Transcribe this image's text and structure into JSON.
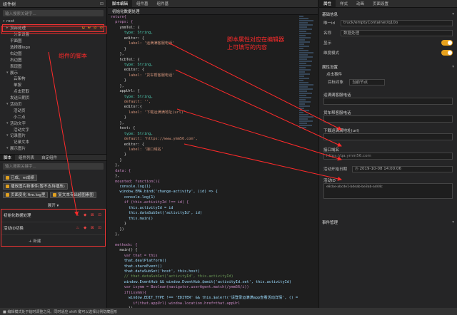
{
  "left": {
    "component_tree_title": "组件树",
    "search_placeholder": "输入搜索关键字...",
    "tree": [
      {
        "label": "root",
        "indent": 0,
        "arrow": "▾"
      },
      {
        "label": "顶部处理",
        "indent": 1,
        "arrow": "▸",
        "selected": true
      },
      {
        "label": "分享设置",
        "indent": 2,
        "arrow": ""
      },
      {
        "label": "平面图",
        "indent": 1,
        "arrow": ""
      },
      {
        "label": "选择器logo",
        "indent": 1,
        "arrow": ""
      },
      {
        "label": "右边图",
        "indent": 1,
        "arrow": ""
      },
      {
        "label": "右边图",
        "indent": 1,
        "arrow": ""
      },
      {
        "label": "表现图",
        "indent": 1,
        "arrow": ""
      },
      {
        "label": "展示",
        "indent": 1,
        "arrow": "▾"
      },
      {
        "label": "云架构",
        "indent": 2,
        "arrow": ""
      },
      {
        "label": "单按",
        "indent": 2,
        "arrow": ""
      },
      {
        "label": "点击获取",
        "indent": 2,
        "arrow": ""
      },
      {
        "label": "发送日期页",
        "indent": 1,
        "arrow": ""
      },
      {
        "label": "活动页",
        "indent": 1,
        "arrow": "▾"
      },
      {
        "label": "活动页",
        "indent": 2,
        "arrow": ""
      },
      {
        "label": "小二点",
        "indent": 2,
        "arrow": ""
      },
      {
        "label": "活动文字",
        "indent": 1,
        "arrow": "▾"
      },
      {
        "label": "活动文字",
        "indent": 2,
        "arrow": ""
      },
      {
        "label": "记录图片",
        "indent": 1,
        "arrow": "▾"
      },
      {
        "label": "记录文本",
        "indent": 2,
        "arrow": ""
      },
      {
        "label": "展示图片",
        "indent": 1,
        "arrow": "▾"
      }
    ],
    "tree_actions": "⧉ ⊕ ◎ ⊘",
    "bottom_tabs": [
      "脚本",
      "组件列表",
      "自定组件"
    ],
    "script_search_placeholder": "输入搜索关键字...",
    "chips": [
      "已成、m成绩",
      "播放图片新事件(暂不支持播放)",
      "页面变化 fire.log里",
      "复文本专出超图素图"
    ],
    "more_label": "展开 ▾",
    "scripts": [
      {
        "label": "初始化数据处理"
      },
      {
        "label": "活动ID切换"
      }
    ],
    "script_icons": "♨ ◆ ⊠ ⊡",
    "new_label": "+ 新建",
    "script_annotation": "组件的脚本"
  },
  "middle": {
    "tabs": [
      "脚本编辑",
      "组件墓",
      "组件墓"
    ],
    "file_tab": "初始化数据处理",
    "code_lines": [
      "return{",
      "  props: {",
      "    ymmTel: {",
      "      type: String,",
      "      editor: {",
      "        label: '运满满客服电话'",
      "      }",
      "    },",
      "    hcbTel: {",
      "      type: String,",
      "      editor: {",
      "        label: '货车帮客服电话'",
      "      }",
      "    },",
      "    appUrl: {",
      "      type: String,",
      "      default: '',",
      "      editor:{",
      "        label: '下载运满满地址(url)'",
      "      }",
      "    },",
      "    host: {",
      "      type: String,",
      "      default: 'https://www.ymm56.com',",
      "      editor: {",
      "        label: '接口域名'",
      "      }",
      "    }",
      "  },",
      "  data: {",
      "  },",
      "  mounted: function(){",
      "    console.log(1)",
      "    window.EMA.bind('change-activity', (id) => {",
      "      console.log(1)",
      "      if (this.activityId !== id) {",
      "        this.activityId = id",
      "        this.dataSubSet('activityId', id)",
      "        this.main()",
      "      }",
      "    })",
      "  },",
      "",
      "  methods: {",
      "    main() {",
      "      var that = this",
      "      that.dealPlatform()",
      "      that.shareEvent()",
      "      that.dataSubSet('host', this.host)",
      "      // that.dataSubSet('activityId', this.activityId)",
      "      window.EventHub && window.EventHub.$emit('activityId.set', this.activityId)",
      "      var isymm = Boolean(navigator.userAgent.match(/ymm56/i))",
      "      if(isymm){",
      "        window.EDIT_TYPE !== 'EDITER' && this.$alert('请登录运满满app查看活动详情', () => {",
      "          if(that.appUrl) window.location.href=that.appUrl",
      "        })",
      "        return",
      "      }",
      "      let { appName, version, platformText, deviceId } = Truck.Env.getAppEnvInfo()"
    ],
    "attr_annotation_1": "脚本属性对应在编辑器",
    "attr_annotation_2": "上可填写的内容"
  },
  "right": {
    "tabs": [
      "属性",
      "样式",
      "动画",
      "页面设置"
    ],
    "basic_section": "基础信息",
    "id_label": "唯一id",
    "id_value": "truck/emptyContainer/q10o",
    "name_label": "名称",
    "name_placeholder": "数据处理",
    "show_label": "显示",
    "freeze_label": "维度模式",
    "attr_section": "属性设置",
    "click_event": "点击事件",
    "bind_label": "目标对象",
    "bind_value": "当前节点",
    "ymm_tel_label": "运满满客服电话",
    "hcb_tel_label": "货车帮客服电话",
    "app_url_label": "下载运满满地址(url)",
    "host_label": "接口域名",
    "host_value": "https://qa.ymm56.com",
    "start_time_label": "活动开始日期",
    "start_time_value": "2019-10-08 14:00:06",
    "activity_id_label": "活动ID",
    "activity_id_value": "e8cbe-abcde1-bdeab-be3ab-ad44c",
    "mgmt_section": "事件管理"
  },
  "status_text": "■ 编辑模式处于临时调整之间。同时适应 shift 键可以选择比例隐藏图形"
}
